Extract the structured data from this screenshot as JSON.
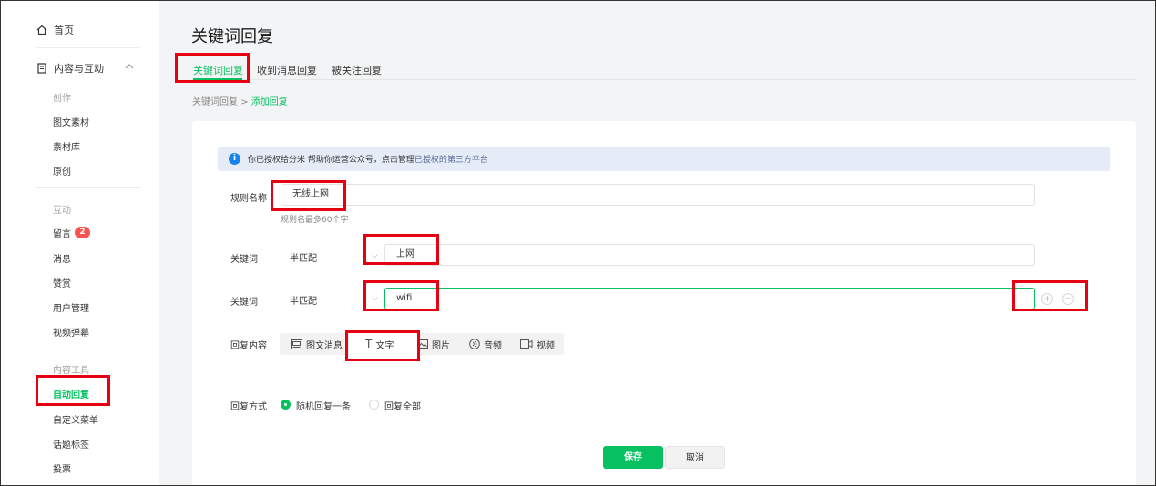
{
  "sidebar": {
    "home": "首页",
    "content_interact": "内容与互动",
    "sec_create": "创作",
    "item_tuwen": "图文素材",
    "item_sucai": "素材库",
    "item_yuanchuang": "原创",
    "sec_interact": "互动",
    "item_liuyan": "留言",
    "liuyan_badge": "2",
    "item_xiaoxi": "消息",
    "item_zanshang": "赞赏",
    "item_yonghu": "用户管理",
    "item_shipin": "视频弹幕",
    "sec_tools": "内容工具",
    "item_auto_reply": "自动回复",
    "item_menu": "自定义菜单",
    "item_topic": "话题标签",
    "item_vote": "投票"
  },
  "main": {
    "page_title": "关键词回复",
    "tabs": [
      "关键词回复",
      "收到消息回复",
      "被关注回复"
    ],
    "breadcrumb_root": "关键词回复",
    "breadcrumb_sep": ">",
    "breadcrumb_current": "添加回复"
  },
  "notice": {
    "text": "你已授权给分米 帮助你运营公众号，点击管理",
    "link": "已授权的第三方平台"
  },
  "form": {
    "rule_name_label": "规则名称",
    "rule_name_value": "无线上网",
    "rule_name_hint": "规则名最多60个字",
    "keyword_label": "关键词",
    "keywords": [
      {
        "match": "半匹配",
        "value": "上网"
      },
      {
        "match": "半匹配",
        "value": "wifi"
      }
    ],
    "reply_content_label": "回复内容",
    "reply_types": [
      "图文消息",
      "文字",
      "图片",
      "音频",
      "视频"
    ],
    "reply_mode_label": "回复方式",
    "reply_modes": [
      "随机回复一条",
      "回复全部"
    ],
    "save": "保存",
    "cancel": "取消"
  },
  "colors": {
    "accent": "#07c160",
    "highlight": "#e60012",
    "notice_bg": "#e5ecf7",
    "info_blue": "#1485ee"
  }
}
